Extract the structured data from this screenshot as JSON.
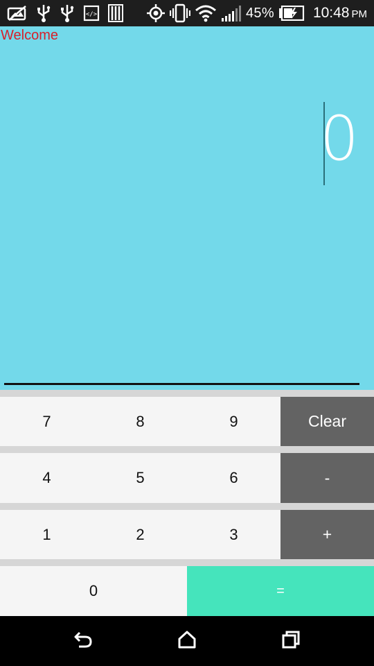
{
  "status_bar": {
    "icons_left": [
      "no-picture-icon",
      "usb-icon",
      "usb-icon",
      "code-icon",
      "storage-icon"
    ],
    "icons_right": [
      "gps-icon",
      "vibrate-icon",
      "wifi-icon",
      "signal-icon",
      "battery-charging-icon"
    ],
    "battery_percent": "45%",
    "time": "10:48",
    "ampm": "PM",
    "text_color": "#ffffff",
    "background": "#1e1e1e"
  },
  "display": {
    "welcome": "Welcome",
    "result": "0",
    "background": "#73d9ea",
    "welcome_color": "#d7202a"
  },
  "keypad": {
    "keys": [
      {
        "label": "7",
        "kind": "digit"
      },
      {
        "label": "8",
        "kind": "digit"
      },
      {
        "label": "9",
        "kind": "digit"
      },
      {
        "label": "Clear",
        "kind": "operator"
      },
      {
        "label": "4",
        "kind": "digit"
      },
      {
        "label": "5",
        "kind": "digit"
      },
      {
        "label": "6",
        "kind": "digit"
      },
      {
        "label": "-",
        "kind": "operator"
      },
      {
        "label": "1",
        "kind": "digit"
      },
      {
        "label": "2",
        "kind": "digit"
      },
      {
        "label": "3",
        "kind": "digit"
      },
      {
        "label": "+",
        "kind": "operator"
      },
      {
        "label": "0",
        "kind": "digit"
      },
      {
        "label": "=",
        "kind": "equals"
      }
    ],
    "colors": {
      "digit": "#f5f5f5",
      "operator": "#636363",
      "equals": "#45e4bc",
      "gap": "#d6d6d6"
    }
  },
  "nav_bar": {
    "buttons": [
      "back-icon",
      "home-icon",
      "recent-apps-icon"
    ]
  }
}
